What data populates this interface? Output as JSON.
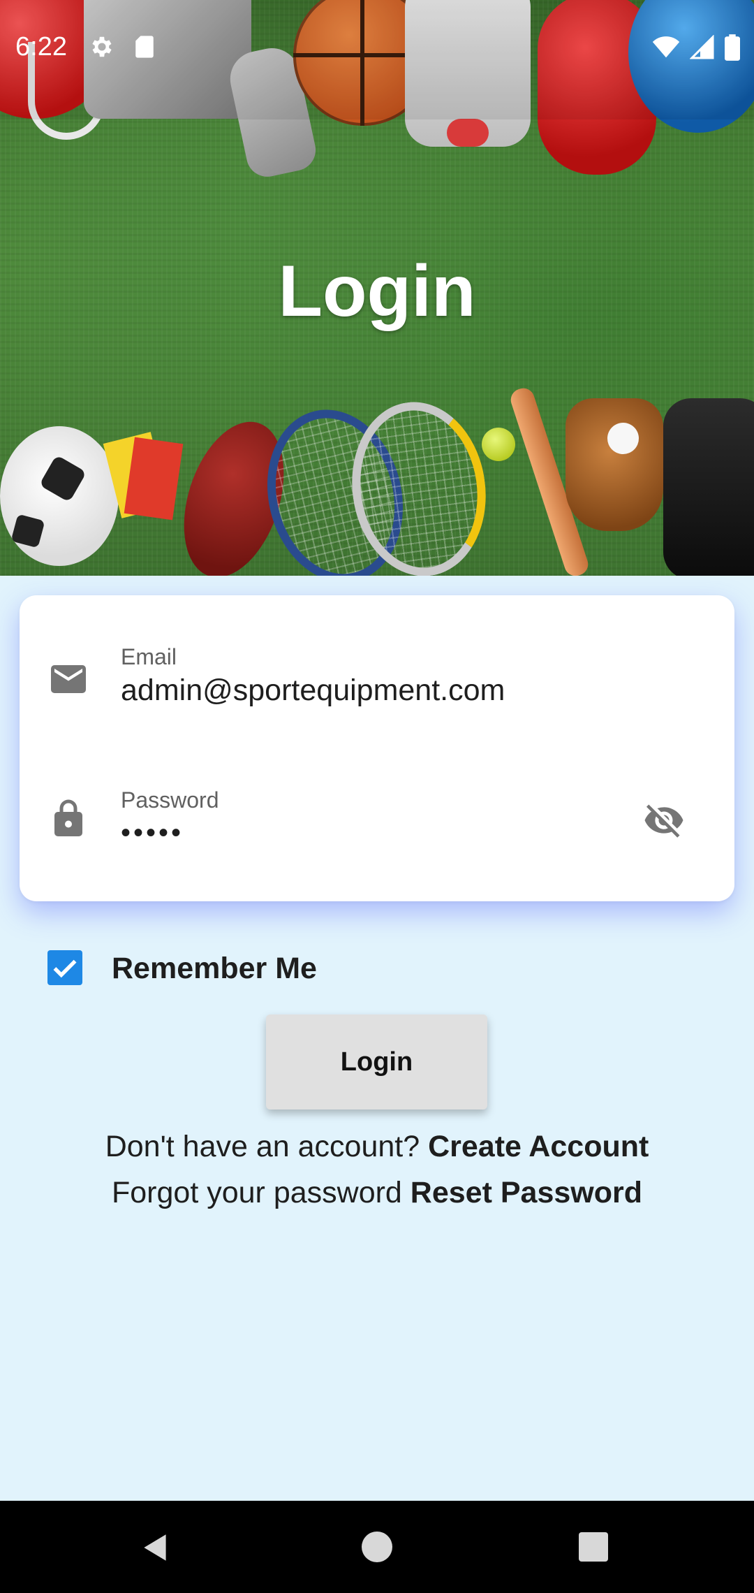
{
  "status_bar": {
    "time": "6:22",
    "icons": [
      "settings-icon",
      "sd-card-icon",
      "wifi-icon",
      "signal-icon",
      "battery-icon"
    ]
  },
  "hero": {
    "title": "Login",
    "background": "sports-equipment-on-grass"
  },
  "form": {
    "email": {
      "label": "Email",
      "value": "admin@sportequipment.com",
      "icon": "mail-icon"
    },
    "password": {
      "label": "Password",
      "value": "•••••",
      "icon": "lock-icon",
      "toggle_icon": "visibility-off-icon"
    }
  },
  "remember_me": {
    "label": "Remember Me",
    "checked": true
  },
  "login_button": {
    "label": "Login"
  },
  "links": {
    "no_account_text": "Don't have an account? ",
    "create_account": "Create Account",
    "forgot_text": "Forgot your password ",
    "reset_password": "Reset Password"
  },
  "colors": {
    "page_background": "#e1f3fc",
    "card_background": "#ffffff",
    "checkbox": "#1e88e5",
    "button_background": "#e0e0e0",
    "nav_bar": "#000000"
  },
  "nav_bar": {
    "icons": [
      "back-icon",
      "home-icon",
      "recents-icon"
    ]
  }
}
